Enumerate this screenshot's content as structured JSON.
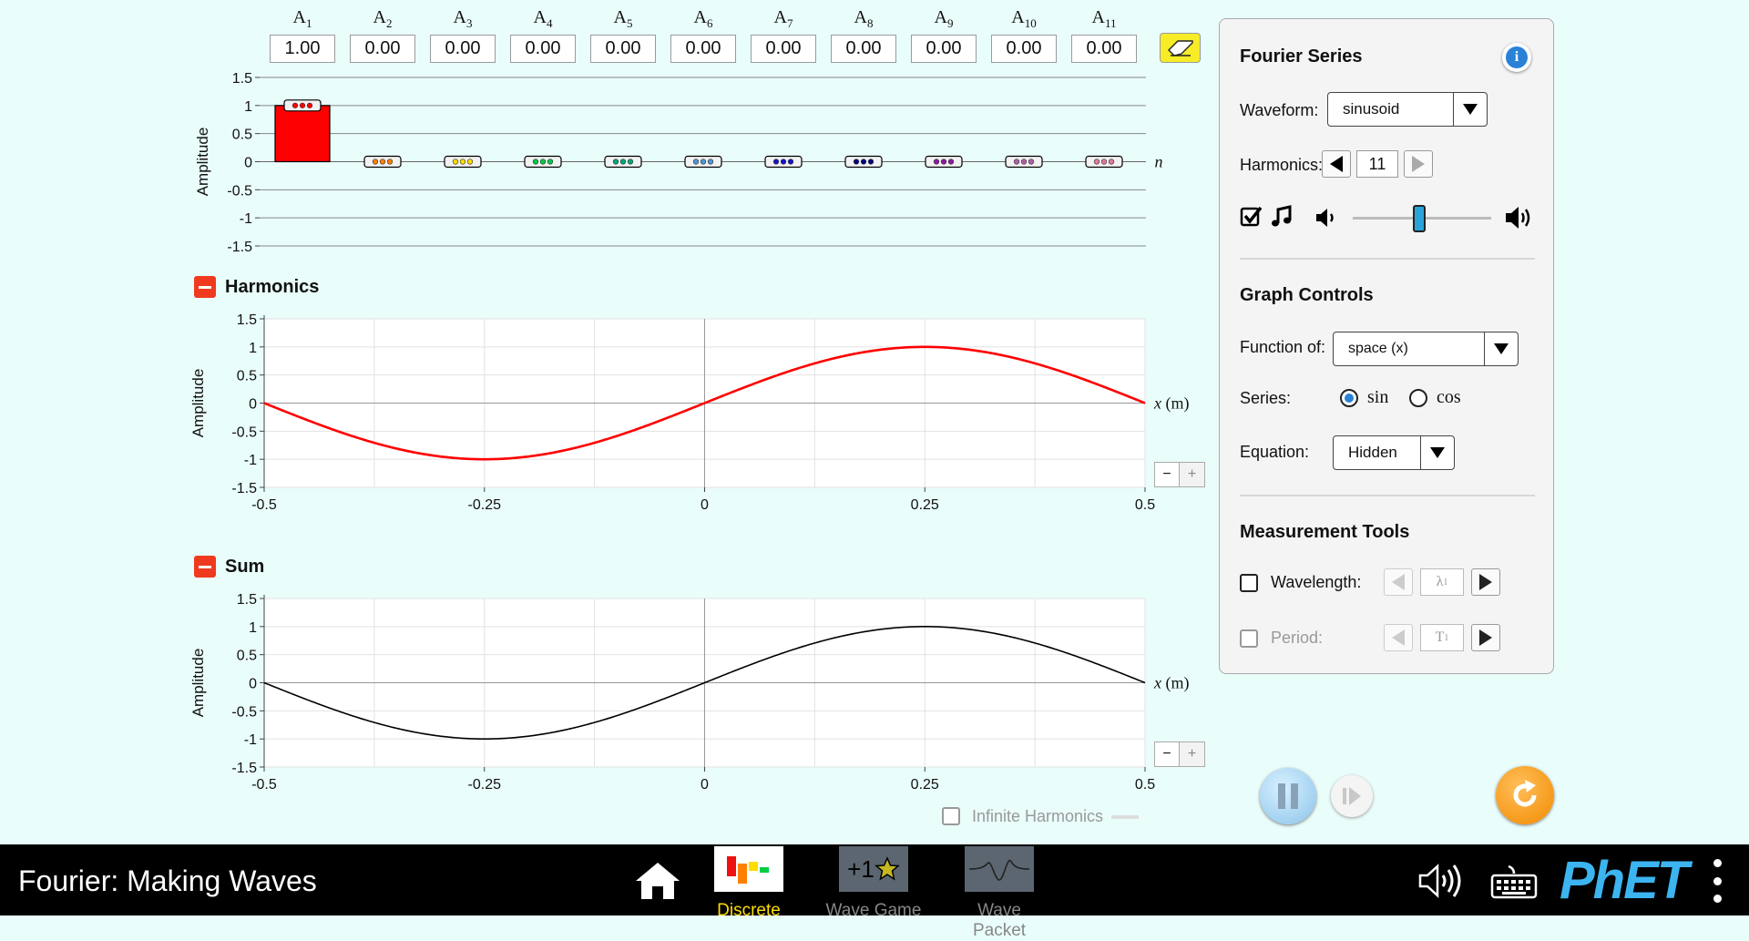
{
  "amplitudes": {
    "labels": [
      {
        "base": "A",
        "sub": "1"
      },
      {
        "base": "A",
        "sub": "2"
      },
      {
        "base": "A",
        "sub": "3"
      },
      {
        "base": "A",
        "sub": "4"
      },
      {
        "base": "A",
        "sub": "5"
      },
      {
        "base": "A",
        "sub": "6"
      },
      {
        "base": "A",
        "sub": "7"
      },
      {
        "base": "A",
        "sub": "8"
      },
      {
        "base": "A",
        "sub": "9"
      },
      {
        "base": "A",
        "sub": "10"
      },
      {
        "base": "A",
        "sub": "11"
      }
    ],
    "values": [
      "1.00",
      "0.00",
      "0.00",
      "0.00",
      "0.00",
      "0.00",
      "0.00",
      "0.00",
      "0.00",
      "0.00",
      "0.00"
    ],
    "colors": [
      "#ff0000",
      "#ff8000",
      "#ffdd00",
      "#00cc44",
      "#00a87a",
      "#5096d6",
      "#1414c8",
      "#000080",
      "#8c1aa6",
      "#b060a8",
      "#e07aa0"
    ],
    "y_axis_label": "Amplitude",
    "n_label": "n",
    "y_ticks": [
      "1.5",
      "1",
      "0.5",
      "0",
      "-0.5",
      "-1",
      "-1.5"
    ]
  },
  "harmonics_section": {
    "title": "Harmonics",
    "y_axis_label": "Amplitude",
    "x_axis_label": "x (m)",
    "zoom_out": "−",
    "zoom_in": "+"
  },
  "sum_section": {
    "title": "Sum",
    "y_axis_label": "Amplitude",
    "x_axis_label": "x (m)",
    "zoom_out": "−",
    "zoom_in": "+"
  },
  "chart_data": [
    {
      "type": "line",
      "x_range": [
        -0.5,
        0.5
      ],
      "ylim": [
        -1.5,
        1.5
      ],
      "x_ticks": [
        "-0.5",
        "-0.25",
        "0",
        "0.25",
        "0.5"
      ],
      "y_ticks": [
        "1.5",
        "1",
        "0.5",
        "0",
        "-0.5",
        "-1",
        "-1.5"
      ],
      "xlabel": "x (m)",
      "ylabel": "Amplitude",
      "grid": true,
      "series": [
        {
          "function": "sin",
          "harmonic": 1,
          "amplitude": 1.0,
          "wavelength": 1.0,
          "color": "#ff0000"
        }
      ]
    },
    {
      "type": "line",
      "x_range": [
        -0.5,
        0.5
      ],
      "ylim": [
        -1.5,
        1.5
      ],
      "x_ticks": [
        "-0.5",
        "-0.25",
        "0",
        "0.25",
        "0.5"
      ],
      "y_ticks": [
        "1.5",
        "1",
        "0.5",
        "0",
        "-0.5",
        "-1",
        "-1.5"
      ],
      "xlabel": "x (m)",
      "ylabel": "Amplitude",
      "grid": true,
      "series": [
        {
          "function": "sin",
          "harmonic": 1,
          "amplitude": 1.0,
          "wavelength": 1.0,
          "color": "#000000"
        }
      ]
    }
  ],
  "infinite_harmonics": {
    "label": "Infinite Harmonics"
  },
  "panel": {
    "fourier_series_title": "Fourier Series",
    "waveform_label": "Waveform:",
    "waveform_value": "sinusoid",
    "harmonics_label": "Harmonics:",
    "harmonics_value": "11",
    "graph_controls_title": "Graph Controls",
    "function_of_label": "Function of:",
    "function_of_value": "space (x)",
    "series_label": "Series:",
    "series_sin": "sin",
    "series_cos": "cos",
    "equation_label": "Equation:",
    "equation_value": "Hidden",
    "measurement_title": "Measurement Tools",
    "wavelength_label": "Wavelength:",
    "wavelength_symbol": "λ",
    "wavelength_sub": "1",
    "period_label": "Period:",
    "period_symbol": "T",
    "period_sub": "1",
    "volume_level": 0.48
  },
  "navbar": {
    "title": "Fourier: Making Waves",
    "tabs": [
      {
        "label": "Discrete",
        "active": true
      },
      {
        "label": "Wave Game",
        "active": false
      },
      {
        "label": "Wave Packet",
        "active": false
      }
    ],
    "wave_game_icon_text": "+1",
    "brand": "PhET",
    "colors": {
      "active_tab": "#ffdd00",
      "inactive_tab": "#888888",
      "brand": "#3cb4f0"
    }
  }
}
